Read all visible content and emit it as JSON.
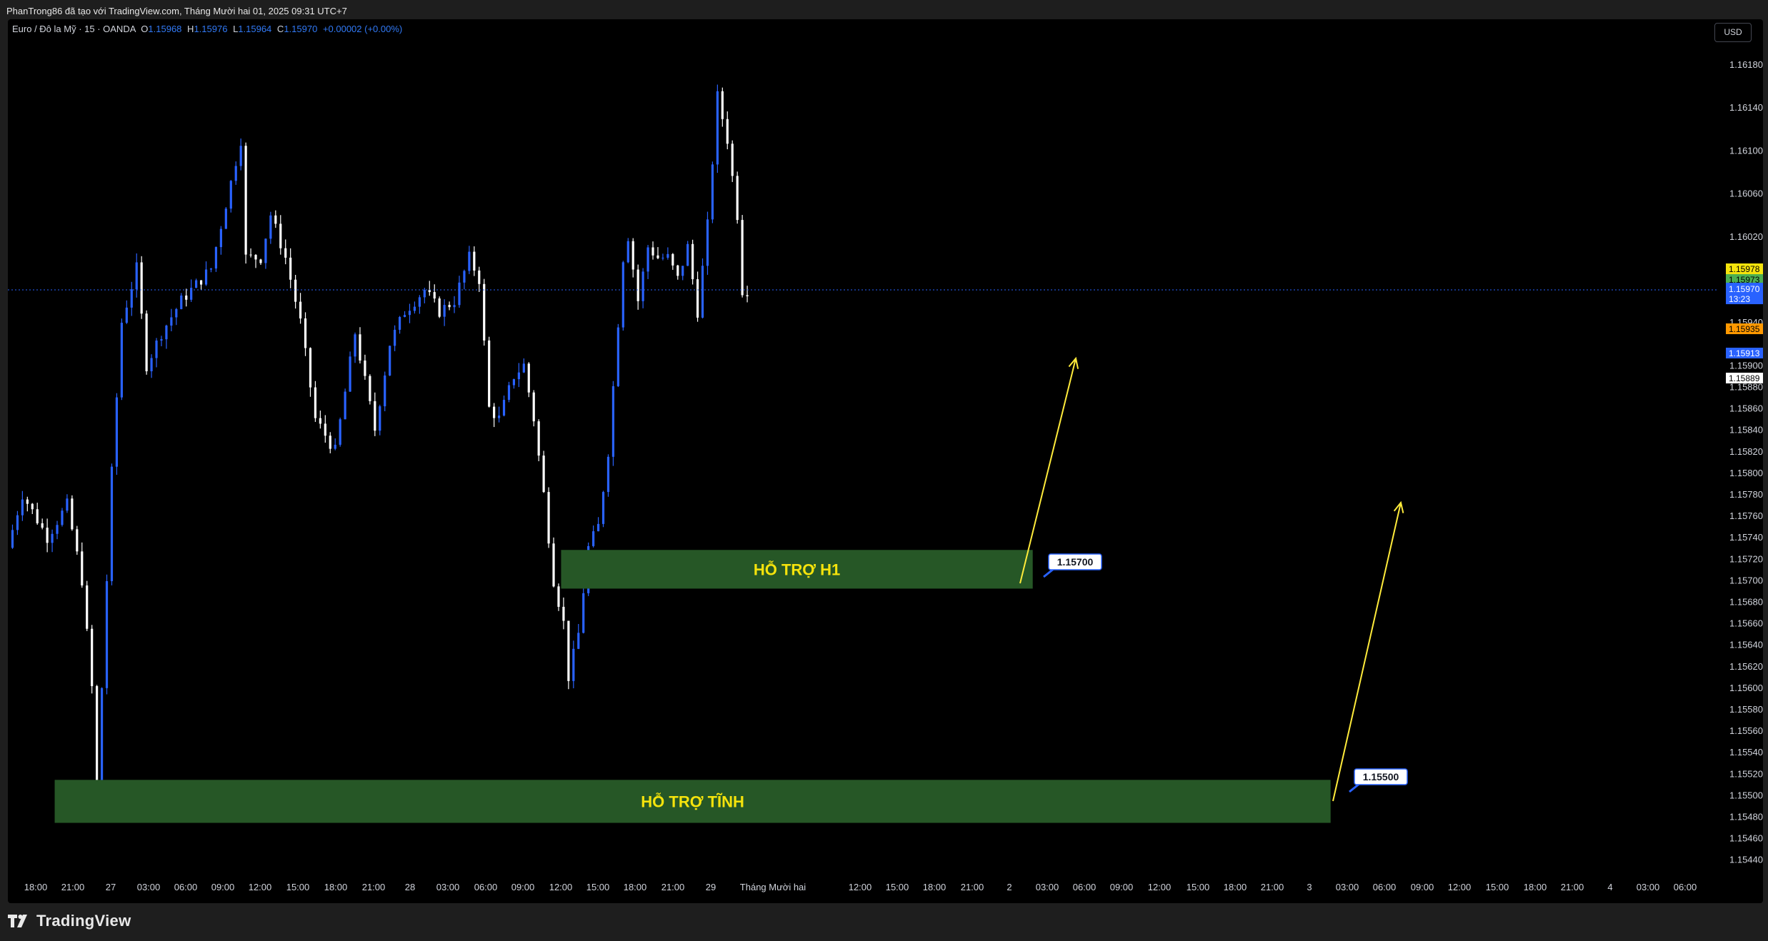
{
  "caption": "PhanTrong86 đã tạo với TradingView.com, Tháng Mười hai 01, 2025 09:31 UTC+7",
  "legend": {
    "symbol": "Euro / Đô la Mỹ · 15 · OANDA",
    "o_label": "O",
    "o_value": "1.15968",
    "h_label": "H",
    "h_value": "1.15976",
    "l_label": "L",
    "l_value": "1.15964",
    "c_label": "C",
    "c_value": "1.15970",
    "change": "+0.00002 (+0.00%)"
  },
  "currency_button": "USD",
  "brand": "TradingView",
  "colors": {
    "background": "#000000",
    "up_candle": "#2962ff",
    "down_candle": "#ffffff",
    "zone_fill": "#265726",
    "zone_text": "#f5e30c",
    "arrow": "#ffeb3b",
    "last_price_badge": "#2962ff"
  },
  "chart_data": {
    "type": "candlestick",
    "title": "Euro / Đô la Mỹ · 15 · OANDA",
    "ylim": [
      1.1543,
      1.1622
    ],
    "y_ticks": [
      "1.16180",
      "1.16140",
      "1.16100",
      "1.16060",
      "1.16020",
      "1.15980",
      "1.15940",
      "1.15900",
      "1.15880",
      "1.15860",
      "1.15840",
      "1.15820",
      "1.15800",
      "1.15780",
      "1.15760",
      "1.15740",
      "1.15720",
      "1.15700",
      "1.15680",
      "1.15660",
      "1.15640",
      "1.15620",
      "1.15600",
      "1.15580",
      "1.15560",
      "1.15540",
      "1.15520",
      "1.15500",
      "1.15480",
      "1.15460",
      "1.15440"
    ],
    "x_ticks": [
      "18:00",
      "21:00",
      "27",
      "03:00",
      "06:00",
      "09:00",
      "12:00",
      "15:00",
      "18:00",
      "21:00",
      "28",
      "03:00",
      "06:00",
      "09:00",
      "12:00",
      "15:00",
      "18:00",
      "21:00",
      "29",
      "Tháng Mười hai",
      "12:00",
      "15:00",
      "18:00",
      "21:00",
      "2",
      "03:00",
      "06:00",
      "09:00",
      "12:00",
      "15:00",
      "18:00",
      "21:00",
      "3",
      "03:00",
      "06:00",
      "09:00",
      "12:00",
      "15:00",
      "18:00",
      "21:00",
      "4",
      "03:00",
      "06:00"
    ],
    "price_path": [
      [
        0,
        1.1573
      ],
      [
        3,
        1.1578
      ],
      [
        8,
        1.1574
      ],
      [
        12,
        1.1577
      ],
      [
        15,
        1.157
      ],
      [
        17,
        1.156
      ],
      [
        18,
        1.1549
      ],
      [
        19,
        1.156
      ],
      [
        21,
        1.158
      ],
      [
        23,
        1.1594
      ],
      [
        26,
        1.1599
      ],
      [
        28,
        1.159
      ],
      [
        31,
        1.1593
      ],
      [
        35,
        1.1596
      ],
      [
        41,
        1.1599
      ],
      [
        44,
        1.1605
      ],
      [
        47,
        1.1611
      ],
      [
        48,
        1.16
      ],
      [
        51,
        1.16
      ],
      [
        53,
        1.1604
      ],
      [
        56,
        1.16
      ],
      [
        59,
        1.1594
      ],
      [
        62,
        1.1585
      ],
      [
        66,
        1.1582
      ],
      [
        70,
        1.1593
      ],
      [
        74,
        1.1584
      ],
      [
        77,
        1.1592
      ],
      [
        80,
        1.1595
      ],
      [
        84,
        1.1597
      ],
      [
        87,
        1.1595
      ],
      [
        90,
        1.1596
      ],
      [
        93,
        1.16
      ],
      [
        95,
        1.1598
      ],
      [
        97,
        1.1586
      ],
      [
        99,
        1.1585
      ],
      [
        102,
        1.1589
      ],
      [
        104,
        1.159
      ],
      [
        106,
        1.1585
      ],
      [
        108,
        1.1578
      ],
      [
        110,
        1.157
      ],
      [
        112,
        1.1566
      ],
      [
        113,
        1.1561
      ],
      [
        115,
        1.1565
      ],
      [
        117,
        1.1573
      ],
      [
        119,
        1.1575
      ],
      [
        121,
        1.1582
      ],
      [
        122,
        1.1588
      ],
      [
        124,
        1.16
      ],
      [
        125,
        1.1602
      ],
      [
        127,
        1.1596
      ],
      [
        129,
        1.1601
      ],
      [
        131,
        1.16
      ],
      [
        133,
        1.16
      ],
      [
        135,
        1.1598
      ],
      [
        137,
        1.1601
      ],
      [
        139,
        1.1595
      ],
      [
        141,
        1.1603
      ],
      [
        143,
        1.1615
      ],
      [
        145,
        1.1611
      ],
      [
        147,
        1.1604
      ],
      [
        148,
        1.1597
      ]
    ],
    "last_price": "1.15970",
    "countdown": "13:23",
    "price_labels": [
      {
        "price": "1.15978",
        "color": "#f5e30c",
        "text_color": "#000000"
      },
      {
        "price": "1.15973",
        "color": "#4caf50",
        "text_color": "#000000"
      },
      {
        "price": "1.15935",
        "color": "#ff9800",
        "text_color": "#000000"
      },
      {
        "price": "1.15913",
        "color": "#2962ff",
        "text_color": "#ffffff"
      },
      {
        "price": "1.15889",
        "color": "#ffffff",
        "text_color": "#000000"
      }
    ],
    "annotations": [
      {
        "type": "zone",
        "label": "HỖ TRỢ H1",
        "top": 1.15728,
        "bottom": 1.15692,
        "x_start": 111,
        "x_end": 206,
        "price_tag": "1.15700"
      },
      {
        "type": "zone",
        "label": "HỖ TRỢ TĨNH",
        "top": 1.15514,
        "bottom": 1.15474,
        "x_start": 9,
        "x_end": 266,
        "price_tag": "1.15500"
      }
    ]
  }
}
